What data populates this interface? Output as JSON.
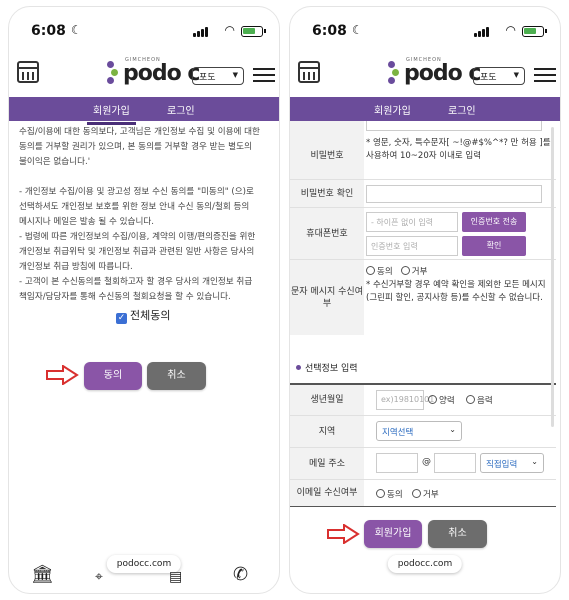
{
  "status": {
    "time": "6:08"
  },
  "header": {
    "logo_sub": "GIMCHEON",
    "logo_text": "podo c",
    "logo_tag": "김천포도회원로스",
    "lang_label": "포도"
  },
  "nav": {
    "join": "회원가입",
    "login": "로그인"
  },
  "left": {
    "terms": [
      "수집/이용에 대한 동의보다, 고객님은 개인정보 수집 및 이용에 대한",
      "동의를 거부할 권리가 있으며, 본 동의를 거부할 경우 받는 별도의",
      "불이익은 없습니다.'",
      "",
      "- 개인정보 수집/이용 및 광고성 정보 수신 동의를 \"미동의\" (으)로",
      "선택하셔도 개인정보 보호를 위한 정보 안내 수신 동의/철회 등의",
      "메시지나 메일은 발송 될 수 있습니다.",
      "- 법령에 따른 개인정보의 수집/이용, 계약의 이행/편의증진을 위한",
      "개인정보 취급위탁 및 개인정보 취급과 관련된 일반 사항은 당사의",
      "개인정보 취급 방침에 따릅니다.",
      "- 고객이 본 수신동의를 철회하고자 할 경우 당사의 개인정보 취급",
      "책임자/담당자를 통해 수신동의 철회요청을 할 수 있습니다."
    ],
    "agree_all": "전체동의",
    "agree_btn": "동의",
    "cancel_btn": "취소",
    "url": "podocc.com"
  },
  "right": {
    "password_label": "비밀번호",
    "password_hint": "* 영문, 숫자, 특수문자[ ~!@#$%^*? 만 허용 ]를 사용하여 10~20자 이내로 입력",
    "password_confirm_label": "비밀번호 확인",
    "phone_label": "휴대폰번호",
    "phone_placeholder": "- 하이픈 없이 입력",
    "send_code_btn": "인증번호 전송",
    "code_placeholder": "인증번호 입력",
    "confirm_btn": "확인",
    "sms_label": "문자 메시지 수신여부",
    "agree": "동의",
    "refuse": "거부",
    "sms_note": "* 수신거부할 경우 예약 확인을 제외한 모든 메시지(그린피 할인, 공지사항 등)를 수신할 수 없습니다.",
    "optional_section": "선택정보 입력",
    "birth_label": "생년월일",
    "birth_placeholder": "ex)19810101",
    "solar": "양력",
    "lunar": "음력",
    "region_label": "지역",
    "region_select": "지역선택",
    "email_label": "메일 주소",
    "at": "@",
    "email_direct": "직접입력",
    "email_recv_label": "이메일 수신여부",
    "join_btn": "회원가입",
    "cancel_btn": "취소",
    "url": "podocc.com"
  }
}
